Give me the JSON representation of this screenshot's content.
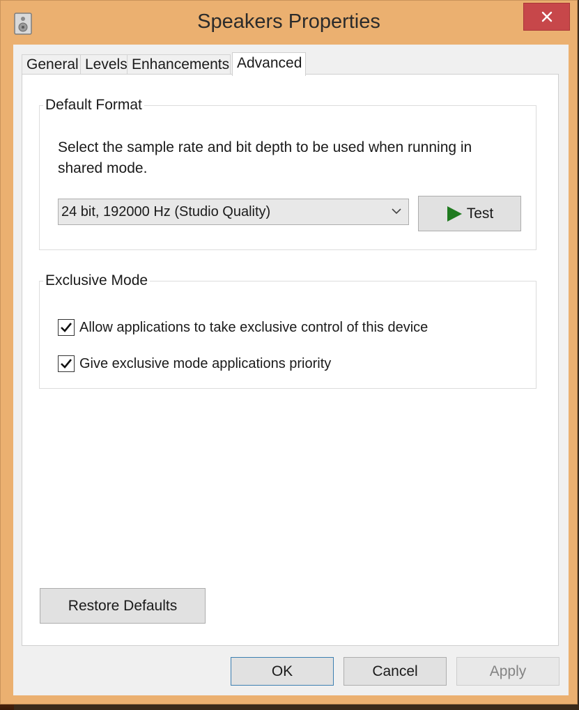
{
  "window": {
    "title": "Speakers Properties"
  },
  "tabs": [
    {
      "label": "General",
      "active": false
    },
    {
      "label": "Levels",
      "active": false
    },
    {
      "label": "Enhancements",
      "active": false
    },
    {
      "label": "Advanced",
      "active": true
    }
  ],
  "default_format": {
    "legend": "Default Format",
    "description": "Select the sample rate and bit depth to be used when running in shared mode.",
    "selected_format": "24 bit, 192000 Hz (Studio Quality)",
    "test_label": "Test"
  },
  "exclusive_mode": {
    "legend": "Exclusive Mode",
    "options": [
      {
        "label": "Allow applications to take exclusive control of this device",
        "checked": true
      },
      {
        "label": "Give exclusive mode applications priority",
        "checked": true
      }
    ]
  },
  "buttons": {
    "restore_defaults": "Restore Defaults",
    "ok": "OK",
    "cancel": "Cancel",
    "apply": "Apply"
  },
  "colors": {
    "frame": "#ebb070",
    "close": "#c7474a",
    "play": "#1f7a1f"
  }
}
